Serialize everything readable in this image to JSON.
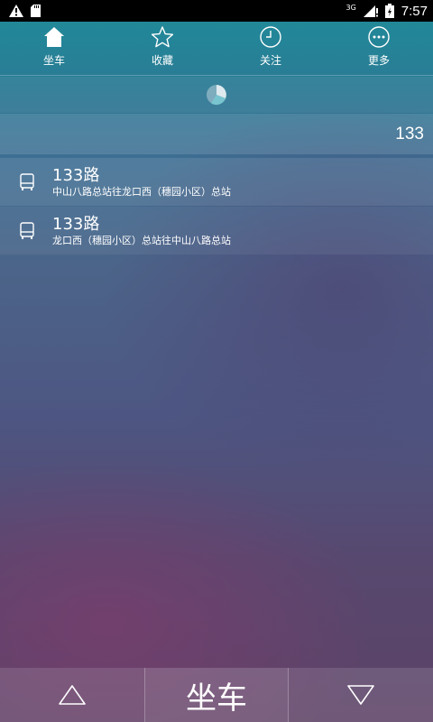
{
  "status_bar": {
    "network": "3G",
    "time": "7:57",
    "icons": [
      "warning-icon",
      "sd-card-icon",
      "signal-icon",
      "battery-icon"
    ]
  },
  "tabs": [
    {
      "label": "坐车",
      "icon": "home-icon",
      "active": true
    },
    {
      "label": "收藏",
      "icon": "star-icon",
      "active": false
    },
    {
      "label": "关注",
      "icon": "clock-icon",
      "active": false
    },
    {
      "label": "更多",
      "icon": "more-icon",
      "active": false
    }
  ],
  "search": {
    "value": "133"
  },
  "routes": [
    {
      "name": "133路",
      "desc": "中山八路总站往龙口西（穗园小区）总站",
      "icon": "bus-icon"
    },
    {
      "name": "133路",
      "desc": "龙口西（穗园小区）总站往中山八路总站",
      "icon": "bus-icon"
    }
  ],
  "bottom_bar": {
    "center_label": "坐车",
    "left_icon": "triangle-up-icon",
    "right_icon": "triangle-down-icon"
  }
}
